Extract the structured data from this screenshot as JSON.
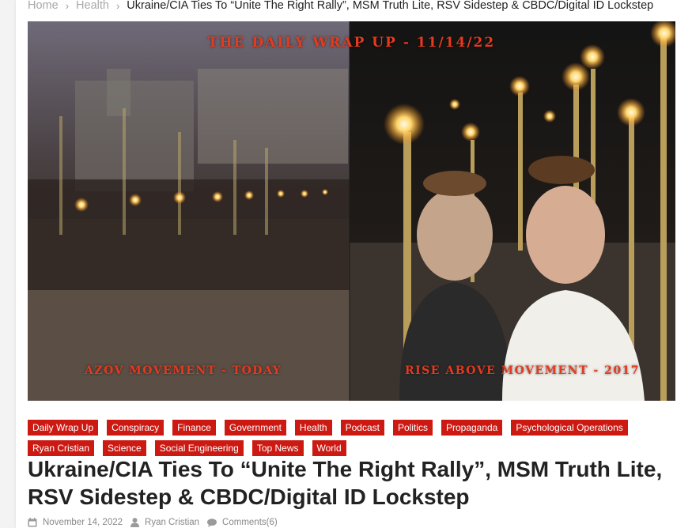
{
  "breadcrumb": {
    "home": "Home",
    "section": "Health",
    "current": "Ukraine/CIA Ties To “Unite The Right Rally”, MSM Truth Lite, RSV Sidestep & CBDC/Digital ID Lockstep"
  },
  "hero": {
    "title": "The Daily Wrap Up - 11/14/22",
    "caption_left": "Azov Movement - Today",
    "caption_right": "Rise Above Movement - 2017",
    "accent": "#e53a1e"
  },
  "categories": [
    "Daily Wrap Up",
    "Conspiracy",
    "Finance",
    "Government",
    "Health",
    "Podcast",
    "Politics",
    "Propaganda",
    "Psychological Operations",
    "Ryan Cristian",
    "Science",
    "Social Engineering",
    "Top News",
    "World"
  ],
  "post": {
    "title": "Ukraine/CIA Ties To “Unite The Right Rally”, MSM Truth Lite, RSV Sidestep & CBDC/Digital ID Lockstep",
    "date": "November 14, 2022",
    "author": "Ryan Cristian",
    "comments": "Comments(6)"
  },
  "colors": {
    "category_bg": "#cc1a13",
    "title_text": "#222222"
  }
}
